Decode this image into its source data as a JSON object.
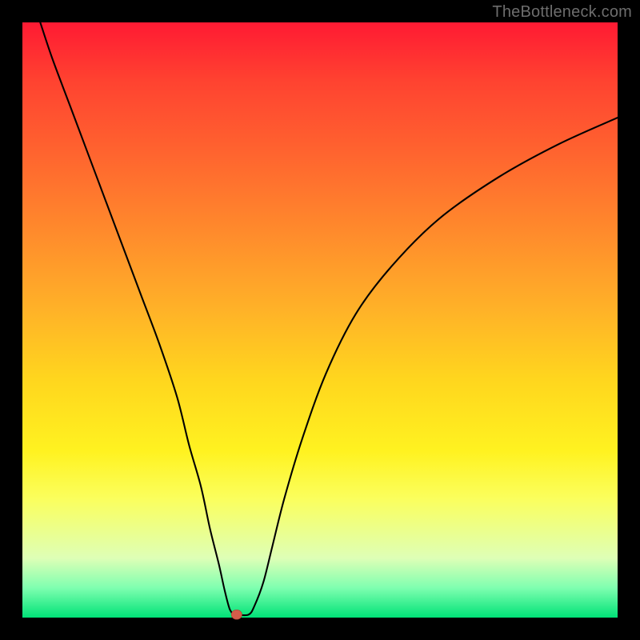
{
  "watermark": "TheBottleneck.com",
  "colors": {
    "frame": "#000000",
    "line": "#000000",
    "marker": "#d35d4a",
    "gradient_top": "#ff1a33",
    "gradient_bottom": "#00e277"
  },
  "chart_data": {
    "type": "line",
    "title": "",
    "xlabel": "",
    "ylabel": "",
    "xlim": [
      0,
      100
    ],
    "ylim": [
      0,
      100
    ],
    "grid": false,
    "legend": false,
    "series": [
      {
        "name": "bottleneck-curve",
        "x": [
          3,
          5,
          8,
          11,
          14,
          17,
          20,
          23,
          26,
          28,
          30,
          31.5,
          33,
          34,
          34.8,
          35.5,
          36,
          38,
          39,
          40.5,
          42,
          44,
          47,
          51,
          56,
          62,
          70,
          80,
          90,
          100
        ],
        "y": [
          100,
          94,
          86,
          78,
          70,
          62,
          54,
          46,
          37,
          29,
          22,
          15,
          9,
          4.5,
          1.5,
          0.5,
          0.5,
          0.5,
          2,
          6,
          12,
          20,
          30,
          41,
          51,
          59,
          67,
          74,
          79.5,
          84
        ]
      }
    ],
    "marker": {
      "x": 36,
      "y": 0.5,
      "size": 12,
      "color": "#d35d4a"
    },
    "notes": "Values estimated from pixel positions; axes are unlabeled in source image (0-100 normalized). The curve descends steeply from upper-left, reaches ~0 near x≈35, then rises asymptotically toward upper-right."
  }
}
